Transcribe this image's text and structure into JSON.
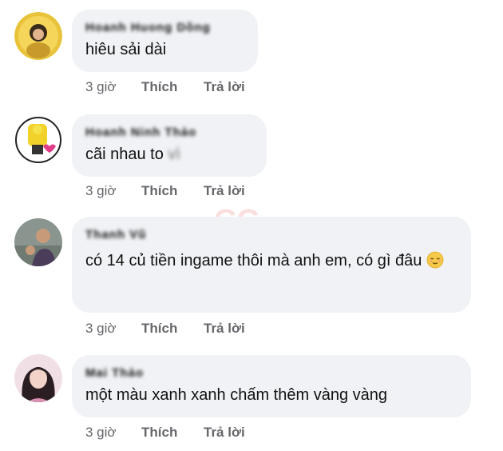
{
  "watermark": "GG",
  "comments": [
    {
      "author": "Hoanh Huong Dồng",
      "text": "hiêu sải dài",
      "tail": "",
      "emoji": "",
      "time": "3 giờ",
      "like": "Thích",
      "reply": "Trả lời"
    },
    {
      "author": "Hoanh Ninh Thảo",
      "text": "cãi nhau to",
      "tail": "vì",
      "emoji": "",
      "time": "3 giờ",
      "like": "Thích",
      "reply": "Trả lời"
    },
    {
      "author": "Thanh Vũ",
      "text": "có 14 củ tiền ingame thôi mà anh em, có gì đâu",
      "tail": "",
      "emoji": "relieved-face",
      "time": "3 giờ",
      "like": "Thích",
      "reply": "Trả lời"
    },
    {
      "author": "Mai Thảo",
      "text": "một màu xanh xanh chấm thêm vàng vàng",
      "tail": "",
      "emoji": "",
      "time": "3 giờ",
      "like": "Thích",
      "reply": "Trả lời"
    }
  ]
}
